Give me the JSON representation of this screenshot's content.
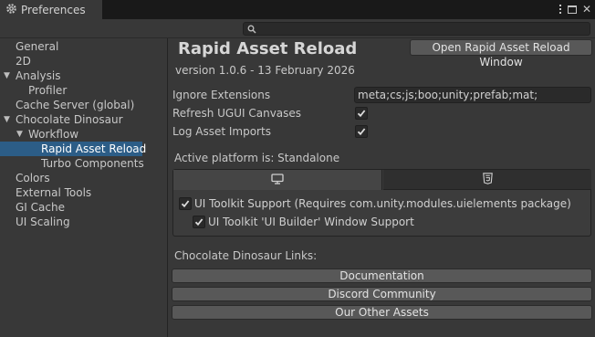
{
  "window": {
    "title": "Preferences"
  },
  "search": {
    "placeholder": "",
    "value": ""
  },
  "sidebar": {
    "items": [
      {
        "label": "General",
        "indent": 0,
        "fold": ""
      },
      {
        "label": "2D",
        "indent": 0,
        "fold": ""
      },
      {
        "label": "Analysis",
        "indent": 0,
        "fold": "▼"
      },
      {
        "label": "Profiler",
        "indent": 1,
        "fold": ""
      },
      {
        "label": "Cache Server (global)",
        "indent": 0,
        "fold": ""
      },
      {
        "label": "Chocolate Dinosaur",
        "indent": 0,
        "fold": "▼"
      },
      {
        "label": "Workflow",
        "indent": 1,
        "fold": "▼"
      },
      {
        "label": "Rapid Asset Reload",
        "indent": 2,
        "fold": "",
        "selected": true
      },
      {
        "label": "Turbo Components",
        "indent": 2,
        "fold": ""
      },
      {
        "label": "Colors",
        "indent": 0,
        "fold": ""
      },
      {
        "label": "External Tools",
        "indent": 0,
        "fold": ""
      },
      {
        "label": "GI Cache",
        "indent": 0,
        "fold": ""
      },
      {
        "label": "UI Scaling",
        "indent": 0,
        "fold": ""
      }
    ]
  },
  "main": {
    "title": "Rapid Asset Reload",
    "open_button": "Open Rapid Asset Reload Window",
    "version": "version 1.0.6 - 13 February 2026",
    "ignore_extensions_label": "Ignore Extensions",
    "ignore_extensions_value": "meta;cs;js;boo;unity;prefab;mat;",
    "refresh_ugui_label": "Refresh UGUI Canvases",
    "refresh_ugui_checked": true,
    "log_imports_label": "Log Asset Imports",
    "log_imports_checked": true,
    "active_platform": "Active platform is: Standalone",
    "platform_tabs": [
      {
        "icon": "monitor-icon",
        "selected": true
      },
      {
        "icon": "html5-icon",
        "selected": false
      }
    ],
    "toolkit_support_label": "UI Toolkit Support (Requires com.unity.modules.uielements package)",
    "toolkit_support_checked": true,
    "builder_support_label": "UI Toolkit 'UI Builder' Window Support",
    "builder_support_checked": true,
    "links_title": "Chocolate Dinosaur Links:",
    "links": [
      "Documentation",
      "Discord Community",
      "Our Other Assets"
    ]
  },
  "colors": {
    "selection": "#2c5d87",
    "panel": "#383838",
    "field": "#2a2a2a",
    "button": "#585858"
  }
}
